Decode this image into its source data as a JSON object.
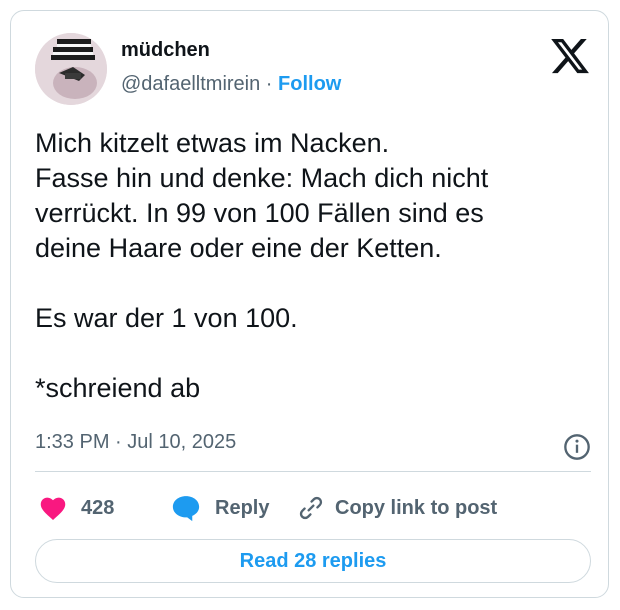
{
  "user": {
    "name": "müdchen",
    "handle": "@dafaelltmirein",
    "separator": " · ",
    "follow_label": "Follow"
  },
  "tweet": {
    "lines": [
      "Mich kitzelt etwas im Nacken.",
      "Fasse hin und denke: Mach dich nicht",
      "verrückt. In 99 von 100 Fällen sind es",
      "deine Haare oder eine der Ketten.",
      "",
      "Es war der 1 von 100.",
      "",
      "*schreiend ab"
    ],
    "timestamp": "1:33 PM · Jul 10, 2025"
  },
  "actions": {
    "like_count": "428",
    "reply_label": "Reply",
    "copy_label": "Copy link to post"
  },
  "read_replies_label": "Read 28 replies",
  "icons": {
    "brand": "x-logo-icon",
    "like": "heart-icon",
    "reply": "speech-bubble-icon",
    "copy": "link-icon",
    "info": "info-icon"
  },
  "colors": {
    "accent": "#1d9bf0",
    "like": "#f91880",
    "secondary_text": "#536471",
    "border": "#cfd9de"
  }
}
